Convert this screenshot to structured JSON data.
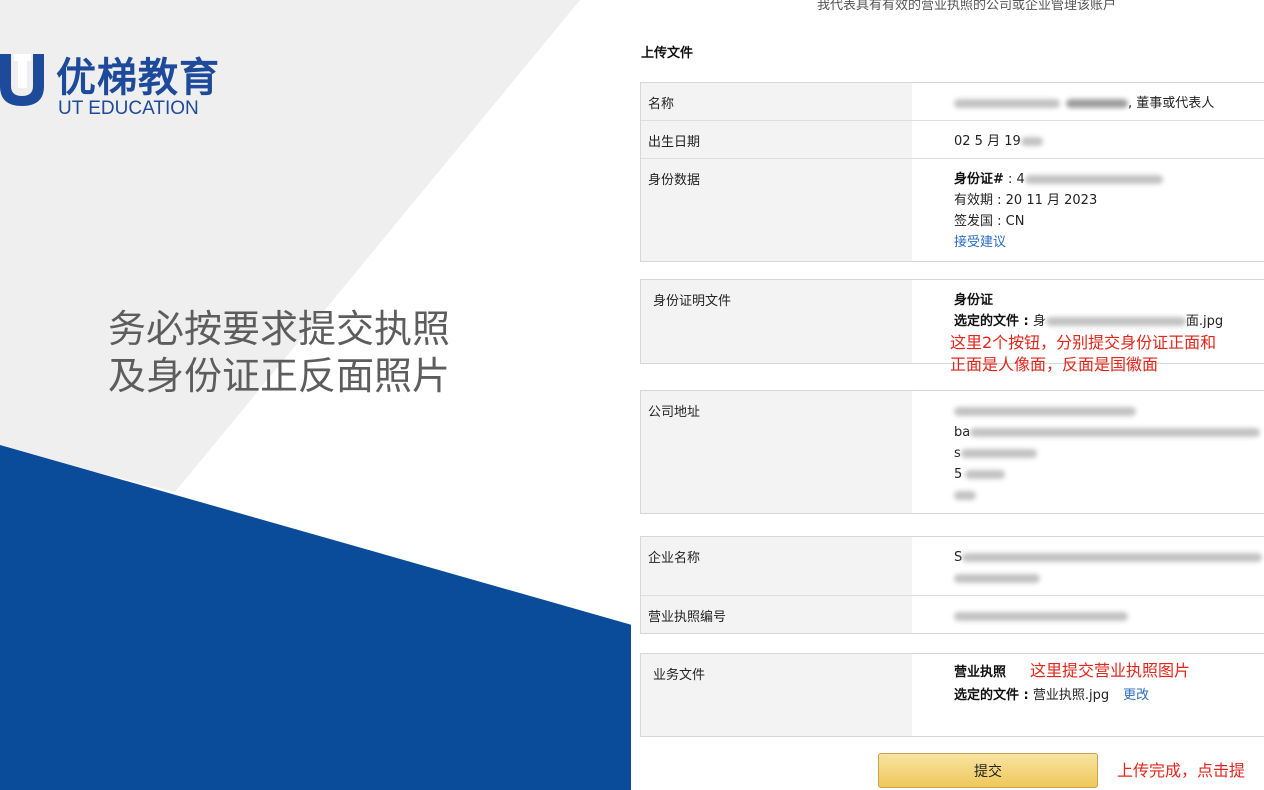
{
  "slide": {
    "logo_cn": "优梯教育",
    "logo_en": "UT EDUCATION",
    "note_line1": "务必按要求提交执照",
    "note_line2": "及身份证正反面照片",
    "colors": {
      "brand_blue": "#0a4c9a",
      "light_band": "#efefef"
    }
  },
  "form": {
    "top_note": "我代表具有有效的营业执照的公司或企业管理该账户",
    "heading": "上传文件",
    "name": {
      "label": "名称",
      "suffix": ", 董事或代表人"
    },
    "dob": {
      "label": "出生日期",
      "prefix": "02 5 月 19"
    },
    "id_data": {
      "label": "身份数据",
      "id_number_label": "身份证#",
      "id_number_sep": " : 4",
      "expiry": "有效期 : 20 11 月 2023",
      "issuer": "签发国 : CN",
      "accept_link": "接受建议"
    },
    "id_doc": {
      "label": "身份证明文件",
      "type": "身份证",
      "selected_label": "选定的文件 :",
      "selected_file_start": " 身",
      "selected_file_end": "面.jpg",
      "annotation_line1": "这里2个按钮，分别提交身份证正面和",
      "annotation_line2": "正面是人像面，反面是国徽面"
    },
    "address": {
      "label": "公司地址",
      "line2_prefix": "ba",
      "line3_prefix": "s",
      "line4_prefix": "5"
    },
    "company": {
      "label": "企业名称",
      "line1_prefix": "S"
    },
    "license_no": {
      "label": "营业执照编号"
    },
    "biz_doc": {
      "label": "业务文件",
      "type": "营业执照",
      "annotation": "这里提交营业执照图片",
      "selected_label": "选定的文件 :",
      "selected_file": " 营业执照.jpg",
      "change_link": "更改"
    },
    "submit_label": "提交",
    "submit_annotation": "上传完成，点击提",
    "colors": {
      "annotation_red": "#e1251b",
      "link_blue": "#2b6dbe",
      "button_gold": "#efc85a"
    }
  }
}
